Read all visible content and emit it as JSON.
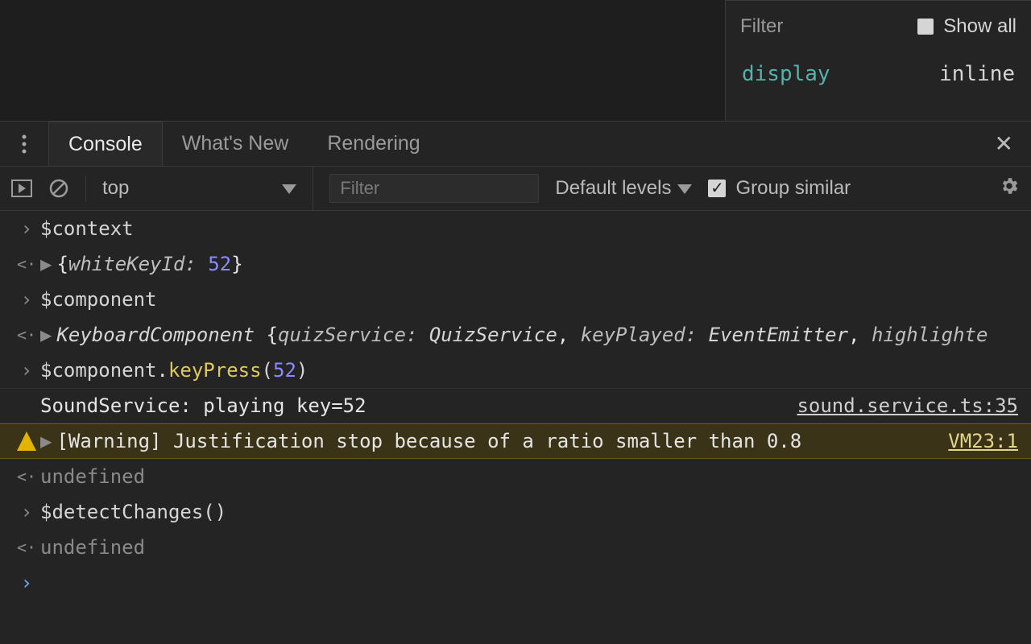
{
  "styles_pane": {
    "filter_placeholder": "Filter",
    "show_all_label": "Show all",
    "prop_name": "display",
    "prop_value": "inline"
  },
  "drawer": {
    "tabs": [
      "Console",
      "What's New",
      "Rendering"
    ],
    "active_index": 0
  },
  "console_toolbar": {
    "context_label": "top",
    "filter_placeholder": "Filter",
    "levels_label": "Default levels",
    "group_similar_label": "Group similar"
  },
  "console_rows": [
    {
      "kind": "input",
      "tokens": [
        [
          "var",
          "$context"
        ]
      ]
    },
    {
      "kind": "result",
      "expandable": true,
      "tokens": [
        [
          "white",
          "{"
        ],
        [
          "key",
          "whiteKeyId: "
        ],
        [
          "num",
          "52"
        ],
        [
          "white",
          "}"
        ]
      ]
    },
    {
      "kind": "input",
      "tokens": [
        [
          "var",
          "$component"
        ]
      ]
    },
    {
      "kind": "result",
      "expandable": true,
      "tokens": [
        [
          "type",
          "KeyboardComponent "
        ],
        [
          "white",
          "{"
        ],
        [
          "key",
          "quizService: "
        ],
        [
          "type",
          "QuizService"
        ],
        [
          "white",
          ", "
        ],
        [
          "key",
          "keyPlayed: "
        ],
        [
          "type",
          "EventEmitter"
        ],
        [
          "white",
          ", "
        ],
        [
          "key",
          "highlighte"
        ]
      ]
    },
    {
      "kind": "input",
      "tokens": [
        [
          "var",
          "$component"
        ],
        [
          "white",
          "."
        ],
        [
          "func",
          "keyPress"
        ],
        [
          "paren",
          "("
        ],
        [
          "num",
          "52"
        ],
        [
          "paren",
          ")"
        ]
      ]
    },
    {
      "kind": "log",
      "text": "SoundService: playing key=52",
      "source": "sound.service.ts:35"
    },
    {
      "kind": "warning",
      "expandable": true,
      "text": "[Warning] Justification stop because of a ratio smaller than 0.8",
      "source": "VM23:1"
    },
    {
      "kind": "result_dim",
      "text": "undefined"
    },
    {
      "kind": "input",
      "tokens": [
        [
          "var",
          "$detectChanges"
        ],
        [
          "paren",
          "()"
        ]
      ]
    },
    {
      "kind": "result_dim",
      "text": "undefined"
    },
    {
      "kind": "prompt"
    }
  ]
}
